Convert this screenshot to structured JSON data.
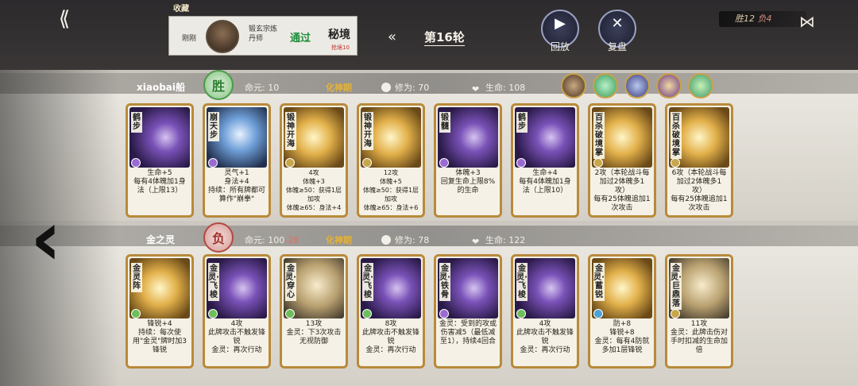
{
  "top": {
    "collect_title": "收藏",
    "opponent_name": "刚刚",
    "opponent_role": "锻玄宗炼丹师",
    "pass_label": "通过",
    "realm_label": "秘境",
    "realm_sub": "抢境10",
    "round_label": "第16轮",
    "replay_label": "回放",
    "review_label": "复盘",
    "record_win": "胜12",
    "record_loss": "负4"
  },
  "player1": {
    "name": "xiaobai船",
    "result": "胜",
    "life_origin_label": "命元:",
    "life_origin_value": "10",
    "realm": "化神期",
    "cultivation_label": "修为:",
    "cultivation_value": "70",
    "hp_label": "生命:",
    "hp_value": "108",
    "cards": [
      {
        "title": "鹤步",
        "desc": "生命+5\n每有4体魄加1身法（上限13）"
      },
      {
        "title": "崩天步",
        "desc": "灵气+1\n身法+4\n持续：所有牌都可算作\"崩拳\""
      },
      {
        "title": "锻神开海",
        "desc": "4攻\n体魄+3\n体魄≥50：获得1层加攻\n体魄≥65：身法+4"
      },
      {
        "title": "锻神开海",
        "desc": "12攻\n体魄+5\n体魄≥50：获得1层加攻\n体魄≥65：身法+6"
      },
      {
        "title": "锻髓",
        "desc": "体魄+3\n回复生命上限8%的生命"
      },
      {
        "title": "鹤步",
        "desc": "生命+4\n每有4体魄加1身法（上限10）"
      },
      {
        "title": "百杀破境掌",
        "desc": "2攻（本轮战斗每加过2体魄多1攻）\n每有25体魄追加1次攻击"
      },
      {
        "title": "百杀破境掌",
        "desc": "6攻（本轮战斗每加过2体魄多1攻）\n每有25体魄追加1次攻击"
      }
    ]
  },
  "player2": {
    "name": "金之灵",
    "result": "负",
    "life_origin_label": "命元:",
    "life_origin_value": "100",
    "life_origin_delta": "-28",
    "realm": "化神期",
    "cultivation_label": "修为:",
    "cultivation_value": "78",
    "hp_label": "生命:",
    "hp_value": "122",
    "cards": [
      {
        "title": "金灵阵",
        "desc": "锋锐+4\n持续：每次使用\"金灵\"牌时加3锋锐"
      },
      {
        "title": "金灵·飞梭",
        "desc": "4攻\n此牌攻击不触发锋锐\n金灵：再次行动"
      },
      {
        "title": "金灵·穿心",
        "desc": "13攻\n金灵：下3次攻击无视防御"
      },
      {
        "title": "金灵·飞梭",
        "desc": "8攻\n此牌攻击不触发锋锐\n金灵：再次行动"
      },
      {
        "title": "金灵·铁骨",
        "desc": "金灵：受到的攻或伤害减5（最低减至1），持续4回合"
      },
      {
        "title": "金灵·飞梭",
        "desc": "4攻\n此牌攻击不触发锋锐\n金灵：再次行动"
      },
      {
        "title": "金灵·蓄锐",
        "desc": "防+8\n锋锐+8\n金灵：每有4防就多加1层锋锐"
      },
      {
        "title": "金灵·巨鼎落",
        "desc": "11攻\n金灵：此牌击伤对手时扣减的生命加倍"
      }
    ]
  }
}
